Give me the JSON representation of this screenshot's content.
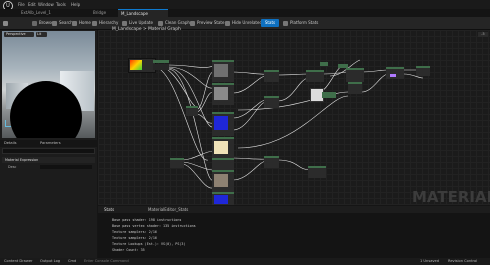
{
  "menu": {
    "items": [
      "File",
      "Edit",
      "Window",
      "Tools",
      "Help"
    ]
  },
  "tabs": [
    {
      "label": "ExtAlb_Level_1",
      "active": false
    },
    {
      "label": "Bridge",
      "active": false
    },
    {
      "label": "M_Landscape",
      "active": true
    }
  ],
  "toolbar": {
    "save_label": "Save",
    "browse_label": "Browse",
    "search_label": "Search",
    "home_label": "Home",
    "hierarchy_label": "Hierarchy",
    "live_update_label": "Live Update",
    "clean_graph_label": "Clean Graph",
    "preview_state_label": "Preview State",
    "hide_unrelated_label": "Hide Unrelated",
    "stats_label": "Stats",
    "platform_stats_label": "Platform Stats"
  },
  "viewport": {
    "mode_label": "Perspective",
    "view_label": "Lit"
  },
  "details": {
    "tab_details": "Details",
    "tab_parameters": "Parameters",
    "search_placeholder": "Search",
    "category": "Material Expression",
    "usage_label": "Desc"
  },
  "graph": {
    "breadcrumb_root": "M_Landscape",
    "breadcrumb_sep": ">",
    "breadcrumb_current": "Material Graph",
    "watermark": "MATERIAL",
    "zoom": "-5"
  },
  "stats": {
    "title": "Stats",
    "source": "MaterialEditor_Stats",
    "lines": [
      "Base pass shader: 198 instructions",
      "Base pass vertex shader: 135 instructions",
      "Texture samplers: 2/16",
      "Texture samplers: 2/16",
      "Texture Lookups (Est.): VS(0), PS(3)",
      "Shader Count: 35"
    ]
  },
  "statusbar": {
    "content_drawer": "Content Drawer",
    "output_log": "Output Log",
    "cmd": "Cmd",
    "console_placeholder": "Enter Console Command",
    "unsaved": "1 Unsaved",
    "revision_control": "Revision Control"
  },
  "colors": {
    "accent": "#0e70c0",
    "node_header": "#3f6e4a",
    "wire": "#e8e8e8"
  }
}
